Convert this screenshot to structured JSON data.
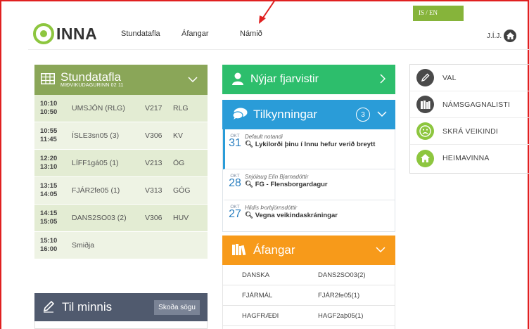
{
  "header": {
    "lang_toggle": "IS / EN",
    "logo_text": "INNA",
    "nav": [
      "Stundatafla",
      "Áfangar",
      "Námið"
    ],
    "user_initials": "J.Í.J."
  },
  "schedule": {
    "title": "Stundatafla",
    "subtitle": "MIÐVIKUDAGURINN 02 11",
    "rows": [
      {
        "start": "10:10",
        "end": "10:50",
        "course": "UMSJÓN (RLG)",
        "room": "V217",
        "teacher": "RLG"
      },
      {
        "start": "10:55",
        "end": "11:45",
        "course": "ÍSLE3sn05 (3)",
        "room": "V306",
        "teacher": "KV"
      },
      {
        "start": "12:20",
        "end": "13:10",
        "course": "LÍFF1gá05 (1)",
        "room": "V213",
        "teacher": "ÓG"
      },
      {
        "start": "13:15",
        "end": "14:05",
        "course": "FJÁR2fe05 (1)",
        "room": "V313",
        "teacher": "GÓG"
      },
      {
        "start": "14:15",
        "end": "15:05",
        "course": "DANS2SO03 (2)",
        "room": "V306",
        "teacher": "HUV"
      },
      {
        "start": "15:10",
        "end": "16:00",
        "course": "Smiðja",
        "room": "",
        "teacher": ""
      }
    ]
  },
  "reminder": {
    "title": "Til minnis",
    "history_button": "Skoða sögu"
  },
  "absence": {
    "title": "Nýjar fjarvistir"
  },
  "announcements": {
    "title": "Tilkynningar",
    "count": "3",
    "items": [
      {
        "month": "OKT",
        "day": "31",
        "author": "Default notandi",
        "subject": "Lykilorði þinu í Innu hefur verið breytt"
      },
      {
        "month": "OKT",
        "day": "28",
        "author": "Snjólaug Elín Bjarnadóttir",
        "subject": "FG - Flensborgardagur"
      },
      {
        "month": "OKT",
        "day": "27",
        "author": "Hildís Þorbjörnsdóttir",
        "subject": "Vegna veikindaskráningar"
      }
    ]
  },
  "courses": {
    "title": "Áfangar",
    "rows": [
      {
        "name": "DANSKA",
        "code": "DANS2SO03(2)"
      },
      {
        "name": "FJÁRMÁL",
        "code": "FJÁR2fe05(1)"
      },
      {
        "name": "HAGFRÆÐI",
        "code": "HAGF2aþ05(1)"
      }
    ]
  },
  "quick_links": [
    {
      "label": "VAL",
      "icon": "pencil-icon",
      "color": "#4a4a4a"
    },
    {
      "label": "NÁMSGAGNALISTI",
      "icon": "books-icon",
      "color": "#4a4a4a"
    },
    {
      "label": "SKRÁ VEIKINDI",
      "icon": "sad-face-icon",
      "color": "#8dc63f"
    },
    {
      "label": "HEIMAVINNA",
      "icon": "home-icon",
      "color": "#8dc63f"
    }
  ],
  "colors": {
    "brand_green": "#8dc63f",
    "schedule_header": "#8aa658",
    "absence_green": "#2dbe6c",
    "announcements_blue": "#2a9cd8",
    "courses_orange": "#f79a1a",
    "reminder_slate": "#505a6e",
    "annotation_red": "#e02020"
  }
}
